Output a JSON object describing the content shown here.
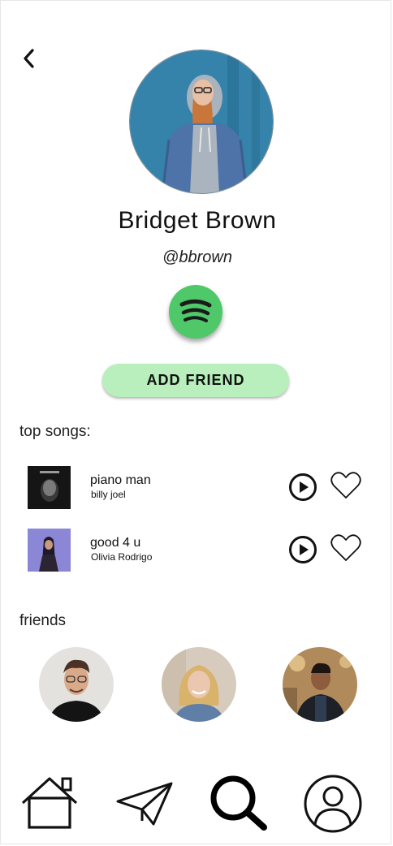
{
  "profile": {
    "name": "Bridget Brown",
    "handle": "@bbrown"
  },
  "actions": {
    "add_friend_label": "ADD FRIEND"
  },
  "top_songs": {
    "heading": "top songs:",
    "items": [
      {
        "title": "piano man",
        "artist": "billy joel"
      },
      {
        "title": "good 4 u",
        "artist": "Olivia Rodrigo"
      }
    ]
  },
  "friends": {
    "heading": "friends",
    "count": 3
  },
  "colors": {
    "spotify_green": "#4fc86a",
    "add_friend_bg": "#b8efbc",
    "text": "#111111"
  },
  "icons": [
    "back-arrow-icon",
    "spotify-icon",
    "play-icon",
    "heart-icon",
    "home-icon",
    "send-icon",
    "search-icon",
    "profile-icon"
  ]
}
